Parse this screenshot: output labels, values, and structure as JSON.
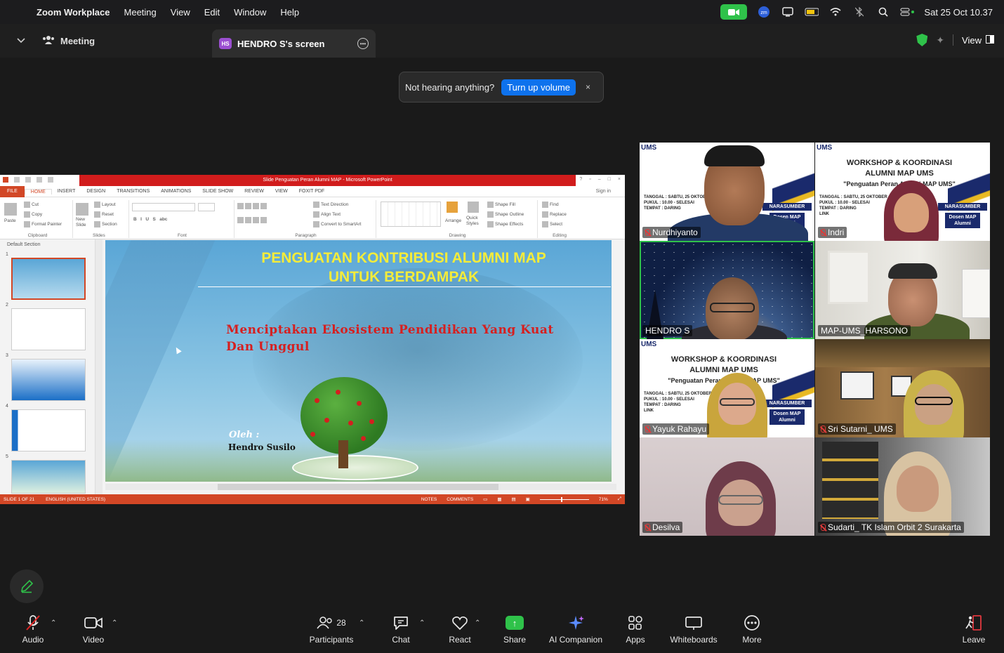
{
  "menubar": {
    "app": "Zoom Workplace",
    "items": [
      "Meeting",
      "View",
      "Edit",
      "Window",
      "Help"
    ],
    "datetime": "Sat 25 Oct  10.37"
  },
  "tabbar": {
    "meeting_label": "Meeting",
    "screen_badge": "HS",
    "screen_tab": "HENDRO S's screen",
    "view_label": "View"
  },
  "notice": {
    "text": "Not hearing anything?",
    "button": "Turn up volume",
    "close": "×"
  },
  "ppt": {
    "window_title": "Slide Penguatan Peran Alumni MAP - Microsoft PowerPoint",
    "tabs": [
      "FILE",
      "HOME",
      "INSERT",
      "DESIGN",
      "TRANSITIONS",
      "ANIMATIONS",
      "SLIDE SHOW",
      "REVIEW",
      "VIEW",
      "FOXIT PDF"
    ],
    "sign_in": "Sign in",
    "ribbon": {
      "paste": "Paste",
      "cut": "Cut",
      "copy": "Copy",
      "format_painter": "Format Painter",
      "clipboard": "Clipboard",
      "new_slide": "New Slide",
      "layout": "Layout",
      "reset": "Reset",
      "section": "Section",
      "slides": "Slides",
      "font": "Font",
      "paragraph": "Paragraph",
      "text_direction": "Text Direction",
      "align_text": "Align Text",
      "convert_smartart": "Convert to SmartArt",
      "arrange": "Arrange",
      "quick_styles": "Quick Styles",
      "shape_fill": "Shape Fill",
      "shape_outline": "Shape Outline",
      "shape_effects": "Shape Effects",
      "drawing": "Drawing",
      "find": "Find",
      "replace": "Replace",
      "select": "Select",
      "editing": "Editing"
    },
    "section_label": "Default Section",
    "slide_numbers": [
      "1",
      "2",
      "3",
      "4",
      "5"
    ],
    "slide": {
      "title_line1": "PENGUATAN KONTRIBUSI ALUMNI MAP",
      "title_line2": "UNTUK BERDAMPAK",
      "subtitle_line1": "Menciptakan Ekosistem Pendidikan Yang Kuat",
      "subtitle_line2": "Dan Unggul",
      "oleh": "Oleh :",
      "author": "Hendro Susilo"
    },
    "status": {
      "slide_of": "SLIDE 1 OF 21",
      "language": "ENGLISH (UNITED STATES)",
      "notes": "NOTES",
      "comments": "COMMENTS",
      "zoom": "71%"
    }
  },
  "gallery": {
    "participants": [
      {
        "name": "Nurdhiyanto"
      },
      {
        "name": "Indri"
      },
      {
        "name": "HENDRO S"
      },
      {
        "name": "MAP-UMS_HARSONO"
      },
      {
        "name": "Yayuk Rahayu"
      },
      {
        "name": "Sri Sutarni_ UMS"
      },
      {
        "name": "Desilva"
      },
      {
        "name": "Sudarti_ TK Islam Orbit 2 Surakarta"
      }
    ],
    "banner": {
      "ums": "UMS",
      "heading_line1": "WORKSHOP & KOORDINASI",
      "heading_line2": "ALUMNI MAP UMS",
      "quote": "\"Penguatan Peran Alumni MAP UMS\"",
      "details": [
        "TANGGAL  : SABTU, 25 OKTOBER",
        "PUKUL     : 10.00 - SELESAI",
        "TEMPAT   : DARING",
        "LINK"
      ],
      "narasumber": "NARASUMBER",
      "dosen": "Dosen MAP Alumni"
    }
  },
  "toolbar": {
    "audio": "Audio",
    "video": "Video",
    "participants": "Participants",
    "participants_count": "28",
    "chat": "Chat",
    "react": "React",
    "share": "Share",
    "ai_companion": "AI Companion",
    "apps": "Apps",
    "whiteboards": "Whiteboards",
    "more": "More",
    "leave": "Leave"
  },
  "colors": {
    "zoom_blue": "#0e72ed",
    "zoom_green": "#2fc24a",
    "ppt_orange": "#d24726",
    "title_yellow": "#f4ec3a",
    "subtitle_red": "#d61f1f"
  }
}
